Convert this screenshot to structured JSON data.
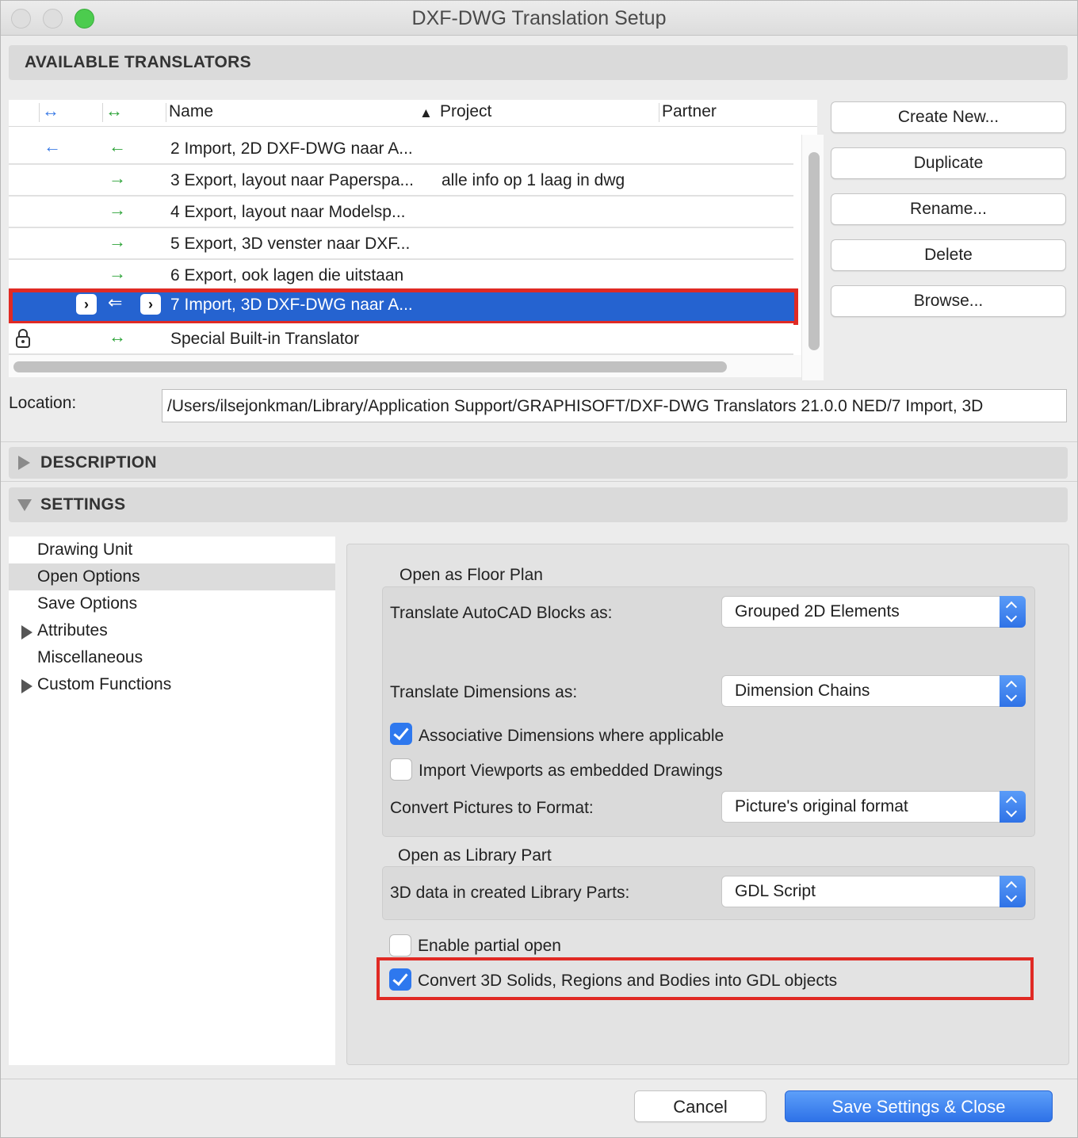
{
  "window": {
    "title": "DXF-DWG Translation Setup"
  },
  "available": {
    "section_label": "AVAILABLE TRANSLATORS",
    "columns": {
      "name": "Name",
      "project": "Project",
      "partner": "Partner",
      "sort_indicator": "▲"
    },
    "header_icons": [
      "double-arrow-blue",
      "double-arrow-green"
    ],
    "rows": [
      {
        "name": "2 Import, 2D DXF-DWG naar A...",
        "project": "",
        "arrow1": "←",
        "arrow2": "←"
      },
      {
        "name": "3 Export, layout naar Paperspa...",
        "project": "alle info op 1 laag in dwg",
        "arrow1": "",
        "arrow2": "→"
      },
      {
        "name": "4 Export, layout naar Modelsp...",
        "project": "",
        "arrow1": "",
        "arrow2": "→"
      },
      {
        "name": "5 Export, 3D venster naar DXF...",
        "project": "",
        "arrow1": "",
        "arrow2": "→"
      },
      {
        "name": "6 Export, ook lagen die uitstaan",
        "project": "",
        "arrow1": "",
        "arrow2": "→"
      },
      {
        "name": "7 Import, 3D DXF-DWG naar A...",
        "project": "",
        "arrow1": "",
        "arrow2": "⇐",
        "selected": true
      },
      {
        "name": "Special Built-in Translator",
        "project": "",
        "arrow1": "lock",
        "arrow2": "↔"
      }
    ],
    "buttons": {
      "create_new": "Create New...",
      "duplicate": "Duplicate",
      "rename": "Rename...",
      "delete": "Delete",
      "browse": "Browse..."
    }
  },
  "location": {
    "label": "Location:",
    "value": "/Users/ilsejonkman/Library/Application Support/GRAPHISOFT/DXF-DWG Translators 21.0.0 NED/7 Import, 3D"
  },
  "description": {
    "section_label": "DESCRIPTION",
    "expanded": false
  },
  "settings": {
    "section_label": "SETTINGS",
    "expanded": true,
    "tree": [
      {
        "label": "Drawing Unit",
        "expandable": false
      },
      {
        "label": "Open Options",
        "expandable": false,
        "selected": true
      },
      {
        "label": "Save Options",
        "expandable": false
      },
      {
        "label": "Attributes",
        "expandable": true
      },
      {
        "label": "Miscellaneous",
        "expandable": false
      },
      {
        "label": "Custom Functions",
        "expandable": true
      }
    ],
    "floor_plan": {
      "group_title": "Open as Floor Plan",
      "blocks_label": "Translate AutoCAD Blocks as:",
      "blocks_value": "Grouped 2D Elements",
      "dimensions_label": "Translate Dimensions as:",
      "dimensions_value": "Dimension Chains",
      "assoc_label": "Associative Dimensions where applicable",
      "assoc_checked": true,
      "viewports_label": "Import Viewports as embedded Drawings",
      "viewports_checked": false,
      "pictures_label": "Convert Pictures to Format:",
      "pictures_value": "Picture's original format"
    },
    "library_part": {
      "group_title": "Open as Library Part",
      "data_label": "3D data in created Library Parts:",
      "data_value": "GDL Script"
    },
    "partial_label": "Enable partial open",
    "partial_checked": false,
    "convert_label": "Convert 3D Solids, Regions and Bodies into GDL objects",
    "convert_checked": true
  },
  "footer": {
    "cancel": "Cancel",
    "save": "Save Settings & Close"
  },
  "colors": {
    "selection": "#2563d0",
    "highlight_box": "#e02a24",
    "accent": "#2e78ee"
  }
}
